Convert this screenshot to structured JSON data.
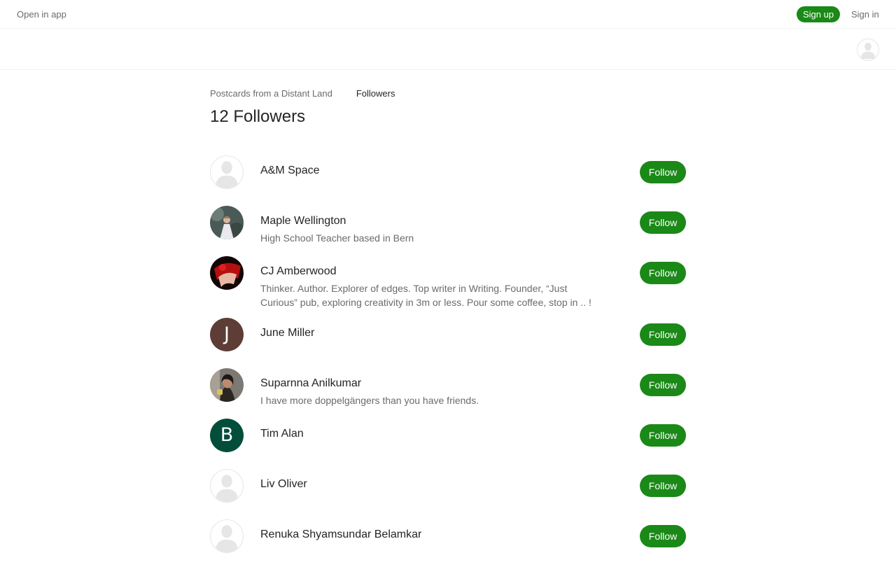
{
  "header": {
    "open_in_app": "Open in app",
    "sign_up": "Sign up",
    "sign_in": "Sign in"
  },
  "breadcrumb": {
    "publication": "Postcards from a Distant Land",
    "current": "Followers"
  },
  "page": {
    "title": "12 Followers"
  },
  "follow_label": "Follow",
  "colors": {
    "accent": "#1a8917",
    "avatar_june": "#5d3d35",
    "avatar_tim": "#024e3a"
  },
  "followers": [
    {
      "name": "A&M Space",
      "bio": "",
      "avatar": "default-avatar-icon"
    },
    {
      "name": "Maple Wellington",
      "bio": "High School Teacher based in Bern",
      "avatar": "photo"
    },
    {
      "name": "CJ Amberwood",
      "bio": "Thinker. Author. Explorer of edges. Top writer in Writing. Founder, “Just Curious” pub, exploring creativity in 3m or less. Pour some coffee, stop in .. !",
      "avatar": "photo"
    },
    {
      "name": "June Miller",
      "bio": "",
      "avatar_letter": "J"
    },
    {
      "name": "Suparnna Anilkumar",
      "bio": "I have more doppelgängers than you have friends.",
      "avatar": "photo"
    },
    {
      "name": "Tim Alan",
      "bio": "",
      "avatar_letter": "B"
    },
    {
      "name": "Liv Oliver",
      "bio": "",
      "avatar": "default-avatar-icon"
    },
    {
      "name": "Renuka Shyamsundar Belamkar",
      "bio": "",
      "avatar": "default-avatar-icon"
    }
  ]
}
